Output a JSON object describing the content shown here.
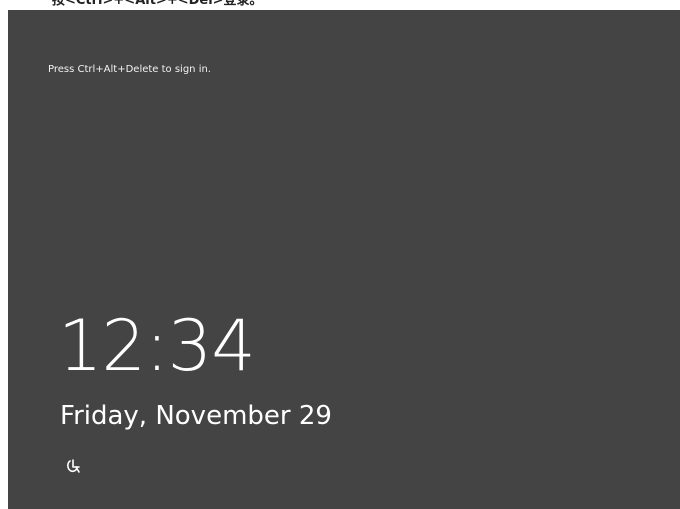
{
  "caption": {
    "text": "按<Ctrl>+<Alt>+<Del>登录。"
  },
  "lock_screen": {
    "signin_hint": "Press Ctrl+Alt+Delete to sign in.",
    "time": "12:34",
    "date": "Friday, November 29",
    "ease_of_access_icon": "ease-of-access-icon"
  },
  "colors": {
    "background": "#444444",
    "text": "#ffffff"
  }
}
